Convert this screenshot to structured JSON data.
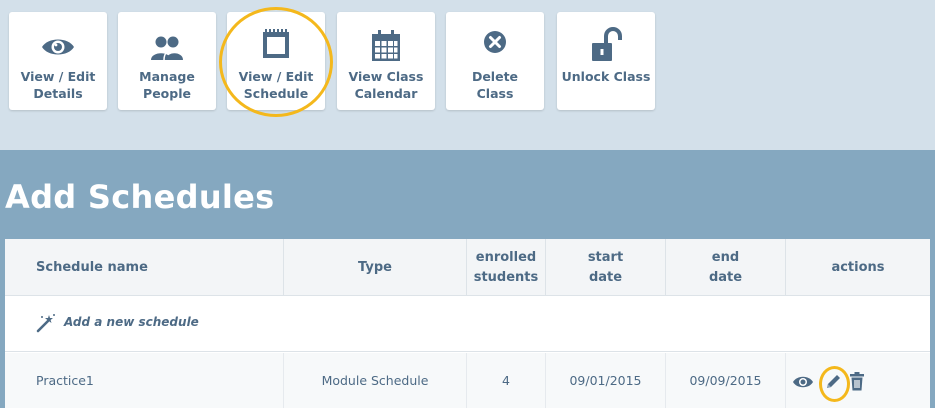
{
  "toolbar": {
    "buttons": [
      {
        "line1": "View / Edit",
        "line2": "Details",
        "icon": "eye-icon"
      },
      {
        "line1": "Manage",
        "line2": "People",
        "icon": "people-icon"
      },
      {
        "line1": "View / Edit",
        "line2": "Schedule",
        "icon": "notepad-icon"
      },
      {
        "line1": "View Class",
        "line2": "Calendar",
        "icon": "calendar-icon"
      },
      {
        "line1": "Delete",
        "line2": "Class",
        "icon": "close-circle-icon"
      },
      {
        "line1": "Unlock Class",
        "line2": "",
        "icon": "unlock-icon"
      }
    ]
  },
  "page": {
    "title": "Add Schedules"
  },
  "table": {
    "headers": {
      "name": "Schedule name",
      "type": "Type",
      "enrolled_1": "enrolled",
      "enrolled_2": "students",
      "start_1": "start",
      "start_2": "date",
      "end_1": "end",
      "end_2": "date",
      "actions": "actions"
    },
    "add_label": "Add a new schedule",
    "rows": [
      {
        "name": "Practice1",
        "type": "Module Schedule",
        "enrolled": "4",
        "start": "09/01/2015",
        "end": "09/09/2015"
      }
    ]
  },
  "colors": {
    "accent_text": "#4d6a85",
    "icon": "#4d6a85",
    "highlight": "#f4b81c",
    "panel_bg": "#85a8c0",
    "toolbar_bg": "#d3e0ea"
  }
}
